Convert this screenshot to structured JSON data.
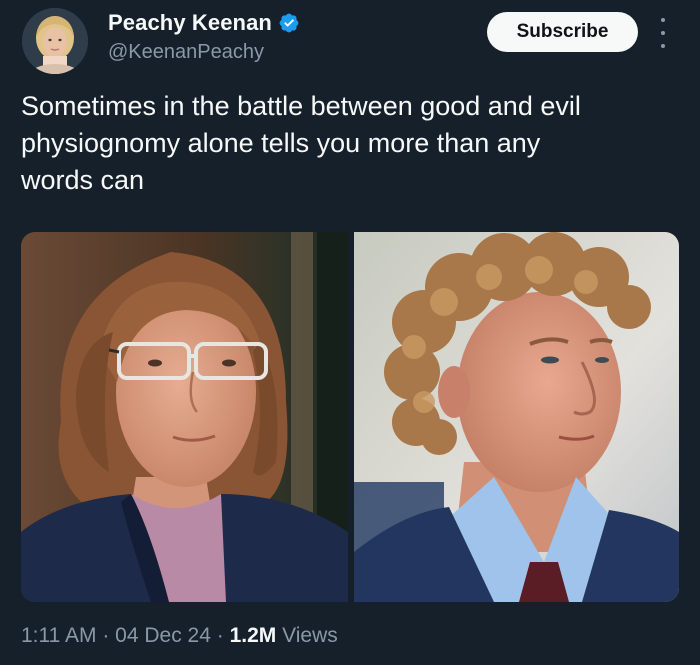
{
  "author": {
    "display_name": "Peachy Keenan",
    "handle": "@KeenanPeachy",
    "verified_icon": "verified-badge-icon"
  },
  "actions": {
    "subscribe_label": "Subscribe",
    "more_icon": "more-vertical-icon"
  },
  "tweet": {
    "text_lines": [
      "Sometimes in the battle between good and evil",
      "physiognomy alone tells you more than any",
      "words can"
    ]
  },
  "meta": {
    "time": "1:11 AM",
    "sep1": " · ",
    "date": "04 Dec 24",
    "sep2": " · ",
    "views_count": "1.2M",
    "views_label": " Views"
  },
  "colors": {
    "background": "#15202b",
    "text_primary": "#f7f9f9",
    "text_secondary": "#8b98a5",
    "verified_blue": "#1d9bf0"
  }
}
